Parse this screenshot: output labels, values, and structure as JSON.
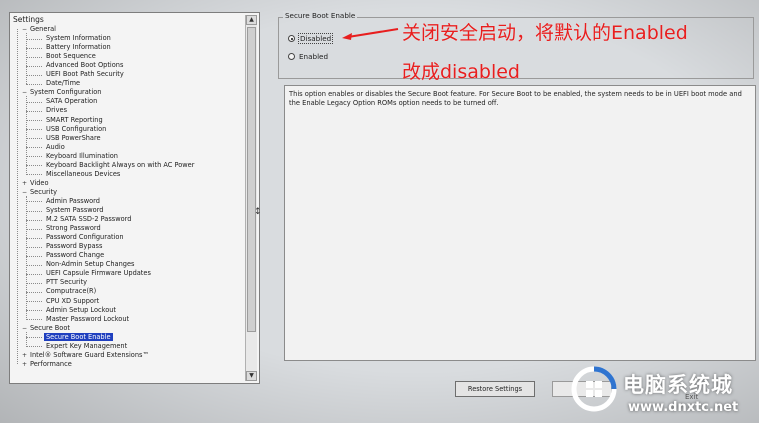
{
  "tree": {
    "header": "Settings",
    "items": [
      {
        "label": "General",
        "level": 0,
        "toggle": "−"
      },
      {
        "label": "System Information",
        "level": 1
      },
      {
        "label": "Battery Information",
        "level": 1
      },
      {
        "label": "Boot Sequence",
        "level": 1
      },
      {
        "label": "Advanced Boot Options",
        "level": 1
      },
      {
        "label": "UEFI Boot Path Security",
        "level": 1
      },
      {
        "label": "Date/Time",
        "level": 1
      },
      {
        "label": "System Configuration",
        "level": 0,
        "toggle": "−"
      },
      {
        "label": "SATA Operation",
        "level": 1
      },
      {
        "label": "Drives",
        "level": 1
      },
      {
        "label": "SMART Reporting",
        "level": 1
      },
      {
        "label": "USB Configuration",
        "level": 1
      },
      {
        "label": "USB PowerShare",
        "level": 1
      },
      {
        "label": "Audio",
        "level": 1
      },
      {
        "label": "Keyboard Illumination",
        "level": 1
      },
      {
        "label": "Keyboard Backlight Always on with AC Power",
        "level": 1
      },
      {
        "label": "Miscellaneous Devices",
        "level": 1
      },
      {
        "label": "Video",
        "level": 0,
        "toggle": "+"
      },
      {
        "label": "Security",
        "level": 0,
        "toggle": "−"
      },
      {
        "label": "Admin Password",
        "level": 1
      },
      {
        "label": "System Password",
        "level": 1
      },
      {
        "label": "M.2 SATA SSD-2 Password",
        "level": 1
      },
      {
        "label": "Strong Password",
        "level": 1
      },
      {
        "label": "Password Configuration",
        "level": 1
      },
      {
        "label": "Password Bypass",
        "level": 1
      },
      {
        "label": "Password Change",
        "level": 1
      },
      {
        "label": "Non-Admin Setup Changes",
        "level": 1
      },
      {
        "label": "UEFI Capsule Firmware Updates",
        "level": 1
      },
      {
        "label": "PTT Security",
        "level": 1
      },
      {
        "label": "Computrace(R)",
        "level": 1
      },
      {
        "label": "CPU XD Support",
        "level": 1
      },
      {
        "label": "Admin Setup Lockout",
        "level": 1
      },
      {
        "label": "Master Password Lockout",
        "level": 1
      },
      {
        "label": "Secure Boot",
        "level": 0,
        "toggle": "−"
      },
      {
        "label": "Secure Boot Enable",
        "level": 1,
        "selected": true
      },
      {
        "label": "Expert Key Management",
        "level": 1
      },
      {
        "label": "Intel® Software Guard Extensions™",
        "level": 0,
        "toggle": "+"
      },
      {
        "label": "Performance",
        "level": 0,
        "toggle": "+"
      }
    ],
    "scroll_up_icon": "▲",
    "scroll_down_icon": "▼"
  },
  "setting": {
    "group_title": "Secure Boot Enable",
    "options": [
      {
        "label": "Disabled",
        "selected": true
      },
      {
        "label": "Enabled",
        "selected": false
      }
    ],
    "description": "This option enables or disables the Secure Boot feature. For Secure Boot to be enabled, the system needs to be in UEFI boot mode and the Enable Legacy Option ROMs option needs to be turned off."
  },
  "buttons": {
    "restore": "Restore Settings",
    "exit": "Exit"
  },
  "annotation": {
    "line1": "关闭安全启动，将默认的Enabled",
    "line2": "改成disabled",
    "color": "#e81e1e"
  },
  "watermark": {
    "title": "电脑系统城",
    "url": "www.dnxtc.net"
  }
}
